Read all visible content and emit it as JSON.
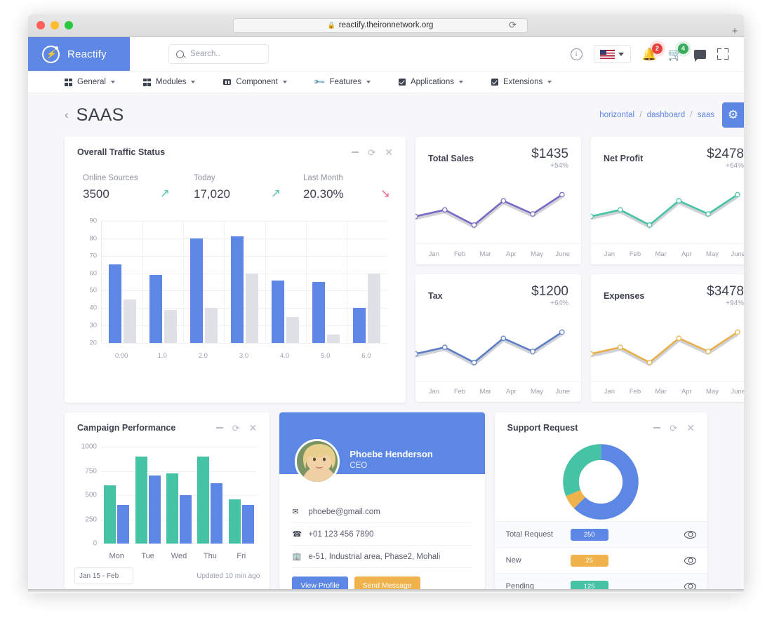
{
  "browser": {
    "url": "reactify.theironnetwork.org",
    "lock_icon": "lock-icon",
    "reload_icon": "reload-icon",
    "newtab_label": "+"
  },
  "header": {
    "brand": "Reactify",
    "logo_icon": "bolt-logo-icon",
    "search_placeholder": "Search..",
    "search_value": "",
    "info_icon": "info-icon",
    "language": "US",
    "notifications_badge": "2",
    "cart_badge": "4",
    "chat_icon": "chat-icon",
    "fullscreen_icon": "fullscreen-icon"
  },
  "nav": {
    "items": [
      {
        "label": "General",
        "icon": "grid-icon"
      },
      {
        "label": "Modules",
        "icon": "grid-icon"
      },
      {
        "label": "Component",
        "icon": "component-icon"
      },
      {
        "label": "Features",
        "icon": "wrench-icon"
      },
      {
        "label": "Applications",
        "icon": "checkbox-icon"
      },
      {
        "label": "Extensions",
        "icon": "checkbox-icon"
      }
    ]
  },
  "page": {
    "title": "SAAS",
    "back_icon": "chevron-left-icon",
    "breadcrumb": [
      "horizontal",
      "dashboard",
      "saas"
    ],
    "settings_icon": "gear-icon"
  },
  "traffic_card": {
    "title": "Overall Traffic Status",
    "tools": [
      "minimize-icon",
      "refresh-icon",
      "close-icon"
    ],
    "stats": [
      {
        "label": "Online Sources",
        "value": "3500",
        "trend": "up"
      },
      {
        "label": "Today",
        "value": "17,020",
        "trend": "up"
      },
      {
        "label": "Last Month",
        "value": "20.30%",
        "trend": "down"
      }
    ]
  },
  "mini_cards": [
    {
      "title": "Total Sales",
      "amount": "$1435",
      "pct": "+54%",
      "color": "#7b68c4"
    },
    {
      "title": "Net Profit",
      "amount": "$2478",
      "pct": "+64%",
      "color": "#46c3a4"
    },
    {
      "title": "Tax",
      "amount": "$1200",
      "pct": "+64%",
      "color": "#5d7ec4"
    },
    {
      "title": "Expenses",
      "amount": "$3478",
      "pct": "+94%",
      "color": "#e8b04b"
    }
  ],
  "campaign_card": {
    "title": "Campaign Performance",
    "tools": [
      "minimize-icon",
      "refresh-icon",
      "close-icon"
    ],
    "date_value": "Jan 15 - Feb",
    "updated": "Updated 10 min ago"
  },
  "profile_card": {
    "name": "Phoebe Henderson",
    "role": "CEO",
    "email": "phoebe@gmail.com",
    "email_icon": "mail-icon",
    "phone": "+01 123 456 7890",
    "phone_icon": "phone-icon",
    "address": "e-51, Industrial area, Phase2, Mohali",
    "address_icon": "building-icon",
    "view_profile_label": "View Profile",
    "send_message_label": "Send Message"
  },
  "support_card": {
    "title": "Support Request",
    "tools": [
      "minimize-icon",
      "refresh-icon",
      "close-icon"
    ],
    "rows": [
      {
        "label": "Total Request",
        "value": "250",
        "color": "#5d87e5",
        "eye_icon": "eye-icon"
      },
      {
        "label": "New",
        "value": "25",
        "color": "#f0b24a",
        "eye_icon": "eye-icon"
      },
      {
        "label": "Pending",
        "value": "125",
        "color": "#46c3a4",
        "eye_icon": "eye-icon"
      }
    ]
  },
  "chart_data": [
    {
      "type": "bar",
      "title": "Overall Traffic Status",
      "categories": [
        "0.00",
        "1.0",
        "2.0",
        "3.0",
        "4.0",
        "5.0",
        "6.0"
      ],
      "series": [
        {
          "name": "Primary",
          "color": "#5d87e5",
          "values": [
            65,
            59,
            80,
            81,
            56,
            55,
            40
          ]
        },
        {
          "name": "Secondary",
          "color": "#dfe1e6",
          "values": [
            45,
            39,
            40,
            60,
            35,
            25,
            60
          ]
        }
      ],
      "ylim": [
        20,
        90
      ],
      "yticks": [
        20,
        30,
        40,
        50,
        60,
        70,
        80,
        90
      ],
      "xlabel": "",
      "ylabel": "",
      "grid": true,
      "legend": "none"
    },
    {
      "type": "line",
      "title": "Total Sales",
      "categories": [
        "Jan",
        "Feb",
        "Mar",
        "Apr",
        "May",
        "June"
      ],
      "values": [
        45,
        58,
        28,
        76,
        50,
        88
      ],
      "color": "#7b68c4",
      "ylim": [
        0,
        100
      ],
      "grid": false,
      "legend": "none"
    },
    {
      "type": "line",
      "title": "Net Profit",
      "categories": [
        "Jan",
        "Feb",
        "Mar",
        "Apr",
        "May",
        "June"
      ],
      "values": [
        45,
        58,
        28,
        76,
        50,
        88
      ],
      "color": "#46c3a4",
      "ylim": [
        0,
        100
      ],
      "grid": false,
      "legend": "none"
    },
    {
      "type": "line",
      "title": "Tax",
      "categories": [
        "Jan",
        "Feb",
        "Mar",
        "Apr",
        "May",
        "June"
      ],
      "values": [
        45,
        58,
        28,
        76,
        50,
        88
      ],
      "color": "#5d7ec4",
      "ylim": [
        0,
        100
      ],
      "grid": false,
      "legend": "none"
    },
    {
      "type": "line",
      "title": "Expenses",
      "categories": [
        "Jan",
        "Feb",
        "Mar",
        "Apr",
        "May",
        "June"
      ],
      "values": [
        45,
        58,
        28,
        76,
        50,
        88
      ],
      "color": "#e8b04b",
      "ylim": [
        0,
        100
      ],
      "grid": false,
      "legend": "none"
    },
    {
      "type": "bar",
      "title": "Campaign Performance",
      "categories": [
        "Mon",
        "Tue",
        "Wed",
        "Thu",
        "Fri"
      ],
      "series": [
        {
          "name": "Series A",
          "color": "#46c3a4",
          "values": [
            600,
            900,
            725,
            900,
            460
          ]
        },
        {
          "name": "Series B",
          "color": "#5d87e5",
          "values": [
            400,
            700,
            500,
            625,
            400
          ]
        }
      ],
      "ylim": [
        0,
        1000
      ],
      "yticks": [
        0,
        250,
        500,
        750,
        1000
      ],
      "xlabel": "",
      "ylabel": "",
      "grid": true,
      "legend": "none"
    },
    {
      "type": "pie",
      "title": "Support Request",
      "labels": [
        "Total Request",
        "New",
        "Pending"
      ],
      "values": [
        250,
        25,
        125
      ],
      "colors": [
        "#5d87e5",
        "#f0b24a",
        "#46c3a4"
      ],
      "donut": true,
      "legend": "none"
    }
  ]
}
